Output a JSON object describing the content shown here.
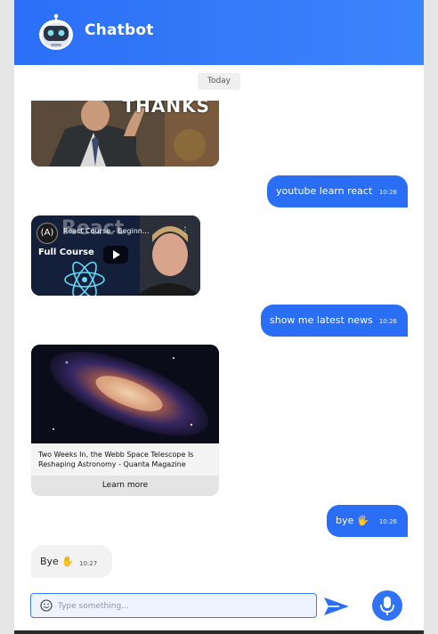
{
  "header": {
    "title": "Chatbot",
    "avatar_icon": "robot-avatar-icon"
  },
  "chat": {
    "day_label": "Today",
    "meme_caption": "THANKS",
    "messages": [
      {
        "from": "user",
        "text": "youtube learn react",
        "time": "10:26"
      },
      {
        "from": "user",
        "text": "show me latest news",
        "time": "10:26"
      },
      {
        "from": "user",
        "text": "bye 🖐️",
        "time": "10:26"
      },
      {
        "from": "bot",
        "text": "Bye ✋",
        "time": "10:27"
      }
    ],
    "youtube_card": {
      "video_title": "React Course - Beginn...",
      "thumb_line1": "React",
      "thumb_line2": "Full Course"
    },
    "news_card": {
      "title": "Two Weeks In, the Webb Space Telescope Is Reshaping Astronomy - Quanta Magazine",
      "button_label": "Learn more"
    }
  },
  "composer": {
    "placeholder": "Type something..."
  },
  "colors": {
    "accent": "#2a6ef6",
    "bot_bubble": "#f2f2f2"
  }
}
